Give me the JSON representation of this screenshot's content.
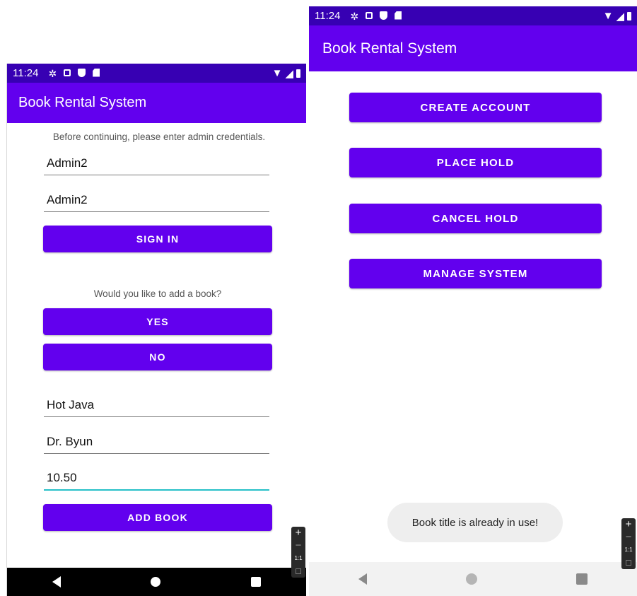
{
  "left_screen": {
    "status_time": "11:24",
    "app_title": "Book Rental System",
    "prompt": "Before continuing, please enter admin credentials.",
    "username_value": "Admin2",
    "password_value": "Admin2",
    "sign_in_label": "SIGN IN",
    "add_book_question": "Would you like to add a book?",
    "yes_label": "YES",
    "no_label": "NO",
    "title_value": "Hot Java",
    "author_value": "Dr. Byun",
    "price_value": "10.50",
    "add_book_label": "ADD BOOK"
  },
  "right_screen": {
    "status_time": "11:24",
    "app_title": "Book Rental System",
    "buttons": [
      {
        "label": "CREATE ACCOUNT"
      },
      {
        "label": "PLACE HOLD"
      },
      {
        "label": "CANCEL HOLD"
      },
      {
        "label": "MANAGE SYSTEM"
      }
    ],
    "toast_message": "Book title is already in use!"
  },
  "zoom_controls": {
    "plus": "+",
    "minus": "−",
    "fit": "1:1"
  },
  "colors": {
    "primary": "#6200ee",
    "status_bar": "#3700b3",
    "focus_underline": "#26c0c7"
  }
}
